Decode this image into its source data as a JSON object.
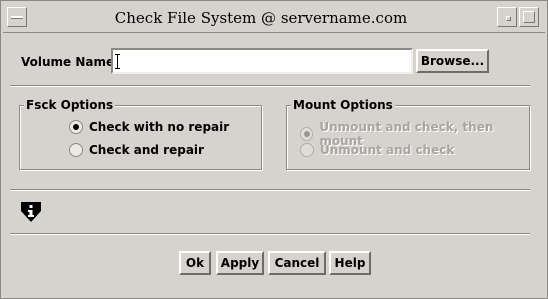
{
  "window": {
    "title": "Check File System @ servername.com"
  },
  "volume": {
    "label": "Volume Name:",
    "value": "",
    "browse_label": "Browse..."
  },
  "fsck": {
    "title": "Fsck Options",
    "options": [
      {
        "label": "Check with no repair",
        "selected": true
      },
      {
        "label": "Check and repair",
        "selected": false
      }
    ]
  },
  "mount": {
    "title": "Mount Options",
    "options": [
      {
        "label": "Unmount and check, then mount",
        "selected": true,
        "disabled": true
      },
      {
        "label": "Unmount and check",
        "selected": false,
        "disabled": true
      }
    ]
  },
  "footer": {
    "icon": "info-icon",
    "buttons": {
      "ok": "Ok",
      "apply": "Apply",
      "cancel": "Cancel",
      "help": "Help"
    }
  },
  "colors": {
    "background": "#d6d2ce",
    "disabled_text": "#a8a4a0"
  }
}
